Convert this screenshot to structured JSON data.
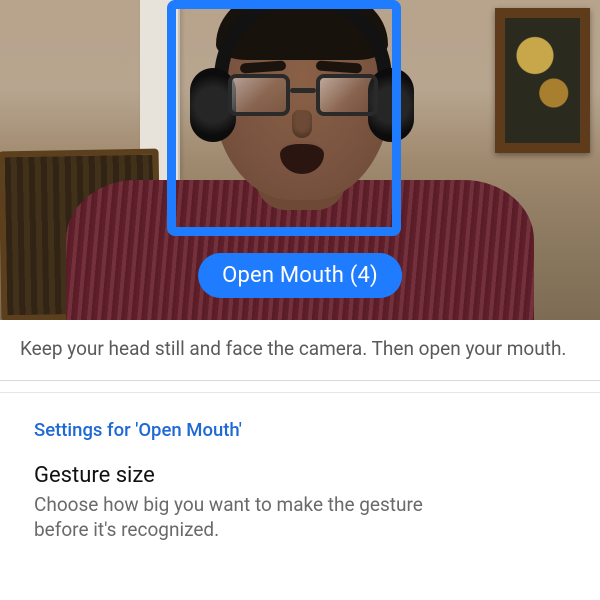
{
  "gesture": {
    "pill_label": "Open Mouth (4)",
    "name": "Open Mouth",
    "count": 4
  },
  "instruction": {
    "text": "Keep your head still and face the camera. Then open your mouth."
  },
  "settings": {
    "header": "Settings for 'Open Mouth'",
    "items": [
      {
        "label": "Gesture size",
        "description": "Choose how big you want to make the gesture before it's recognized."
      }
    ]
  },
  "colors": {
    "accent": "#1f7cff",
    "link": "#1f69d6"
  }
}
